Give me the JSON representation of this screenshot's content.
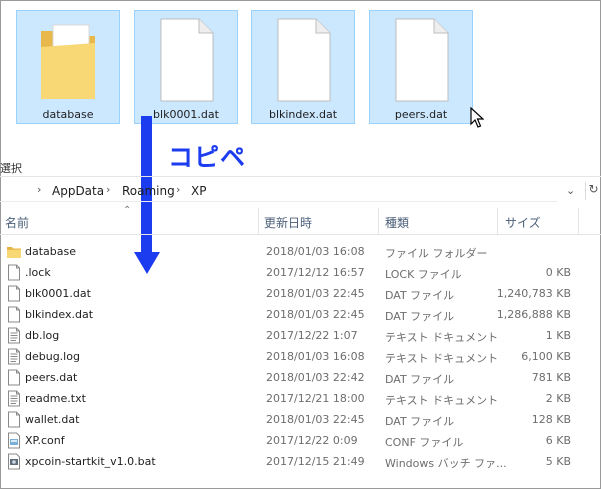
{
  "top_files": [
    {
      "name": "database",
      "icon": "folder-icon"
    },
    {
      "name": "blk0001.dat",
      "icon": "file-icon"
    },
    {
      "name": "blkindex.dat",
      "icon": "file-icon"
    },
    {
      "name": "peers.dat",
      "icon": "file-icon"
    }
  ],
  "annotation": {
    "copy_label": "コピペ",
    "color": "#1c3cf0"
  },
  "ribbon": {
    "select_text": "選択"
  },
  "address": {
    "crumbs": [
      "AppData",
      "Roaming",
      "XP"
    ],
    "separator": "›"
  },
  "columns": {
    "name": "名前",
    "date": "更新日時",
    "type": "種類",
    "size": "サイズ"
  },
  "files": [
    {
      "name": "database",
      "date": "2018/01/03 16:08",
      "type": "ファイル フォルダー",
      "size": "",
      "icon": "folder-icon"
    },
    {
      "name": ".lock",
      "date": "2017/12/12 16:57",
      "type": "LOCK ファイル",
      "size": "0 KB",
      "icon": "file-icon"
    },
    {
      "name": "blk0001.dat",
      "date": "2018/01/03 22:45",
      "type": "DAT ファイル",
      "size": "1,240,783 KB",
      "icon": "file-icon"
    },
    {
      "name": "blkindex.dat",
      "date": "2018/01/03 22:45",
      "type": "DAT ファイル",
      "size": "1,286,888 KB",
      "icon": "file-icon"
    },
    {
      "name": "db.log",
      "date": "2017/12/22 1:07",
      "type": "テキスト ドキュメント",
      "size": "1 KB",
      "icon": "text-file-icon"
    },
    {
      "name": "debug.log",
      "date": "2018/01/03 16:08",
      "type": "テキスト ドキュメント",
      "size": "6,100 KB",
      "icon": "text-file-icon"
    },
    {
      "name": "peers.dat",
      "date": "2018/01/03 22:42",
      "type": "DAT ファイル",
      "size": "781 KB",
      "icon": "file-icon"
    },
    {
      "name": "readme.txt",
      "date": "2017/12/21 18:00",
      "type": "テキスト ドキュメント",
      "size": "2 KB",
      "icon": "text-file-icon"
    },
    {
      "name": "wallet.dat",
      "date": "2018/01/03 22:45",
      "type": "DAT ファイル",
      "size": "128 KB",
      "icon": "file-icon"
    },
    {
      "name": "XP.conf",
      "date": "2017/12/22 0:09",
      "type": "CONF ファイル",
      "size": "6 KB",
      "icon": "config-file-icon"
    },
    {
      "name": "xpcoin-startkit_v1.0.bat",
      "date": "2017/12/15 21:49",
      "type": "Windows バッチ ファ...",
      "size": "5 KB",
      "icon": "batch-file-icon"
    }
  ]
}
